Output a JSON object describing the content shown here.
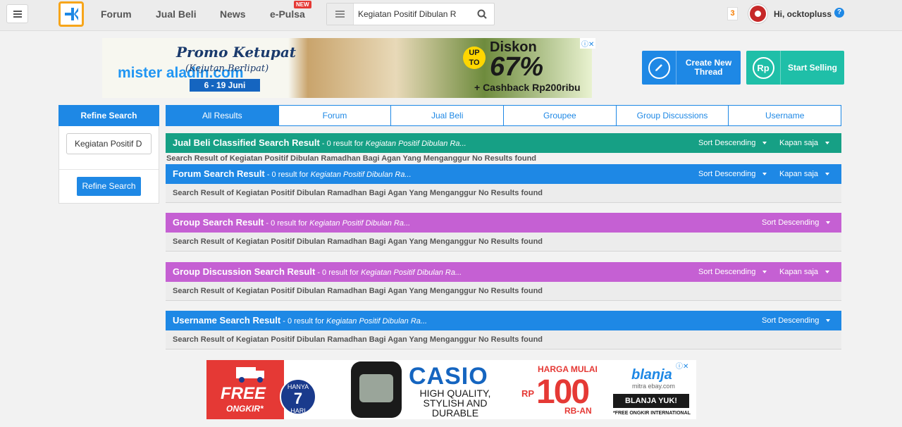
{
  "nav": {
    "items": [
      "Forum",
      "Jual Beli",
      "News",
      "e-Pulsa"
    ],
    "new_badge": "NEW",
    "search_value": "Kegiatan Positif Dibulan R",
    "notif_count": "3",
    "greeting": "Hi, ocktopluss",
    "help": "?"
  },
  "ad_top": {
    "brand": "mister aladin.com",
    "promo": "Promo Ketupat",
    "sub": "(Kejutan Berlipat)",
    "date": "6 - 19 Juni",
    "upto": "UP TO",
    "diskon": "Diskon",
    "pct": "67%",
    "cashback": "+ Cashback Rp200ribu"
  },
  "actions": {
    "create_line1": "Create New",
    "create_line2": "Thread",
    "sell_icon": "Rp",
    "sell": "Start Selling"
  },
  "refine": {
    "title": "Refine Search",
    "input_value": "Kegiatan Positif D",
    "button": "Refine Search"
  },
  "tabs": [
    "All Results",
    "Forum",
    "Jual Beli",
    "Groupee",
    "Group Discussions",
    "Username"
  ],
  "results": [
    {
      "title": "Jual Beli Classified Search Result",
      "count": " - 0 result for ",
      "term": "Kegiatan Positif Dibulan Ra...",
      "sort": "Sort Descending",
      "time": "Kapan saja",
      "color": "#16a085",
      "message": "Search Result of Kegiatan Positif Dibulan Ramadhan Bagi Agan Yang Menganggur No Results found"
    },
    {
      "title": "Forum Search Result",
      "count": " - 0 result for ",
      "term": "Kegiatan Positif Dibulan Ra...",
      "sort": "Sort Descending",
      "time": "Kapan saja",
      "color": "#1e88e5",
      "message": "Search Result of Kegiatan Positif Dibulan Ramadhan Bagi Agan Yang Menganggur No Results found"
    },
    {
      "title": "Group Search Result",
      "count": " - 0 result for ",
      "term": "Kegiatan Positif Dibulan Ra...",
      "sort": "Sort Descending",
      "color": "#c560d3",
      "message": "Search Result of Kegiatan Positif Dibulan Ramadhan Bagi Agan Yang Menganggur No Results found"
    },
    {
      "title": "Group Discussion Search Result",
      "count": " - 0 result for ",
      "term": "Kegiatan Positif Dibulan Ra...",
      "sort": "Sort Descending",
      "time": "Kapan saja",
      "color": "#c560d3",
      "message": "Search Result of Kegiatan Positif Dibulan Ramadhan Bagi Agan Yang Menganggur No Results found"
    },
    {
      "title": "Username Search Result",
      "count": " - 0 result for ",
      "term": "Kegiatan Positif Dibulan Ra...",
      "sort": "Sort Descending",
      "color": "#1e88e5",
      "message": "Search Result of Kegiatan Positif Dibulan Ramadhan Bagi Agan Yang Menganggur No Results found"
    }
  ],
  "ad_bottom": {
    "free": "FREE",
    "ongkir": "ONGKIR*",
    "hanya": "HANYA",
    "hanya_days": "7",
    "hanya_unit": "HARI",
    "casio": "CASIO",
    "tagline": "HIGH QUALITY, STYLISH AND DURABLE WATCHES",
    "harga": "HARGA MULAI",
    "rp": "RP",
    "price": "100",
    "rb": "RB-AN",
    "blanja": "blanja",
    "ebay": "mitra ebay.com",
    "yuk": "BLANJA YUK!",
    "intl": "*FREE ONGKIR INTERNATIONAL"
  }
}
